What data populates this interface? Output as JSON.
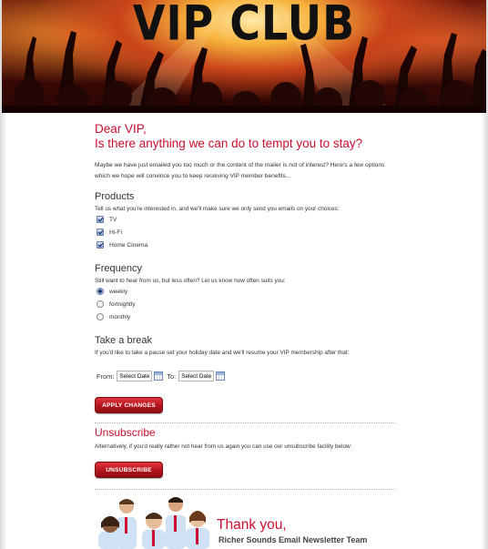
{
  "banner": {
    "title": "VIP CLUB"
  },
  "headline": {
    "line1": "Dear VIP,",
    "line2": "Is there anything we can do to tempt you to stay?"
  },
  "intro": "Maybe we have just emailed you too much or the content of the mailer is not of interest? Here's a few options which we hope will convince you to keep receiving VIP member benefits...",
  "products": {
    "title": "Products",
    "desc": "Tell us what you're interested in, and we'll make sure we only send you emails on your choices:",
    "options": [
      {
        "label": "TV",
        "checked": true
      },
      {
        "label": "Hi-Fi",
        "checked": true
      },
      {
        "label": "Home Cinema",
        "checked": true
      }
    ]
  },
  "frequency": {
    "title": "Frequency",
    "desc": "Still want to hear from us, but less often? Let us know how often suits you:",
    "options": [
      {
        "label": "weekly",
        "selected": true
      },
      {
        "label": "fortnightly",
        "selected": false
      },
      {
        "label": "monthly",
        "selected": false
      }
    ]
  },
  "break": {
    "title": "Take a break",
    "desc": "If you'd like to take a pause set your holiday date and we'll resume your VIP membership after that:",
    "from_label": "From:",
    "to_label": "To:",
    "from_value": "Select Date",
    "to_value": "Select Date",
    "apply_label": "APPLY CHANGES"
  },
  "unsubscribe": {
    "title": "Unsubscribe",
    "desc": "Alternatively, if you'd really rather not hear from us again you can use our unsubscribe facility below:",
    "button_label": "UNSUBSCRIBE"
  },
  "footer": {
    "thanks": "Thank you,",
    "signature": "Richer Sounds Email Newsletter Team"
  },
  "colors": {
    "accent_red": "#c8102e",
    "button_red": "#b4141c",
    "checkbox_blue": "#7ea2e0"
  }
}
